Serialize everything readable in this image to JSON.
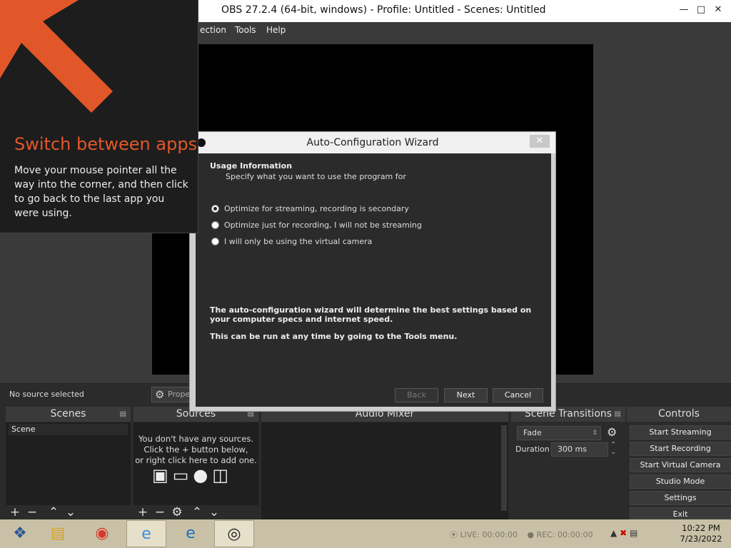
{
  "window": {
    "title": "OBS 27.2.4 (64-bit, windows) - Profile: Untitled - Scenes: Untitled"
  },
  "menu": [
    "ection",
    "Tools",
    "Help"
  ],
  "context_bar": {
    "no_source": "No source selected",
    "properties": "Prope"
  },
  "docks": {
    "scenes": {
      "title": "Scenes",
      "item": "Scene"
    },
    "sources": {
      "title": "Sources",
      "empty_line1": "You don't have any sources.",
      "empty_line2": "Click the + button below,",
      "empty_line3": "or right click here to add one."
    },
    "audio_mixer": {
      "title": "Audio Mixer"
    },
    "transitions": {
      "title": "Scene Transitions",
      "transition": "Fade",
      "duration_label": "Duration",
      "duration_value": "300 ms"
    },
    "controls": {
      "title": "Controls",
      "buttons": [
        "Start Streaming",
        "Start Recording",
        "Start Virtual Camera",
        "Studio Mode",
        "Settings",
        "Exit"
      ]
    }
  },
  "wizard": {
    "title": "Auto-Configuration Wizard",
    "header": "Usage Information",
    "subheader": "Specify what you want to use the program for",
    "options": [
      {
        "label": "Optimize for streaming, recording is secondary",
        "selected": true
      },
      {
        "label": "Optimize just for recording, I will not be streaming",
        "selected": false
      },
      {
        "label": "I will only be using the virtual camera",
        "selected": false
      }
    ],
    "info1": "The auto-configuration wizard will determine the best settings based on your computer specs and internet speed.",
    "info2": "This can be run at any time by going to the Tools menu.",
    "back": "Back",
    "next": "Next",
    "cancel": "Cancel"
  },
  "tip": {
    "title": "Switch between apps",
    "body": "Move your mouse pointer all the way into the corner, and then click to go back to the last app you were using."
  },
  "status": {
    "live": "LIVE: 00:00:00",
    "rec": "REC: 00:00:00"
  },
  "clock": {
    "time": "10:22 PM",
    "date": "7/23/2022"
  },
  "colors": {
    "tip_accent": "#e2572a",
    "taskbar": "#c9c1a7"
  }
}
